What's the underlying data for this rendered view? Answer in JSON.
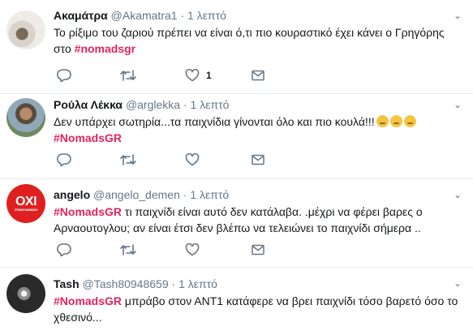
{
  "tweets": [
    {
      "name": "Ακαμάτρα",
      "handle": "@Akamatra1",
      "sep": "·",
      "time": "1 λεπτό",
      "text_before": "Το ρίξιμο του ζαριού πρέπει να είναι ό,τι πιο κουραστικό έχει κάνει ο Γρηγόρης στο ",
      "hashtag": "#nomadsgr",
      "text_after": "",
      "like_count": "1"
    },
    {
      "name": "Ρούλα Λέκκα",
      "handle": "@arglekka",
      "sep": "·",
      "time": "1 λεπτό",
      "text_before": "Δεν υπάρχει σωτηρία...τα παιχνίδια γίνονται όλο και πιο κουλά!!!",
      "hashtag": "#NomadsGR",
      "text_after": "",
      "like_count": ""
    },
    {
      "name": "angelo",
      "handle": "@angelo_demen",
      "sep": "·",
      "time": "1 λεπτό",
      "text_before": "",
      "hashtag": "#NomadsGR",
      "text_after": " τι παιχνίδι είναι αυτό δεν κατάλαβα. .μέχρι  να φέρει βαρες ο Αρναουτογλου; αν είναι έτσι δεν βλέπω να τελειώνει το παιχνίδι σήμερα ..",
      "like_count": "",
      "avatar_text": "ΟΧΙ",
      "avatar_small": "ΣΤΗΝ ΕΞΑΘΛΙΩΣΗ"
    },
    {
      "name": "Tash",
      "handle": "@Tash80948659",
      "sep": "·",
      "time": "1 λεπτό",
      "text_before": "",
      "hashtag": "#NomadsGR",
      "text_after": " μπράβο στον ΑΝΤ1 κατάφερε να βρει παιχνίδι τόσο βαρετό όσο το χθεσινό...",
      "like_count": ""
    }
  ],
  "icons": {
    "caret": "chevron-down-icon",
    "reply": "reply-icon",
    "retweet": "retweet-icon",
    "like": "heart-icon",
    "dm": "envelope-icon",
    "emoji": "disappointed-face-icon"
  },
  "colors": {
    "hashtag": "#e0245e",
    "muted": "#657786",
    "divider": "#e6ecf0"
  }
}
